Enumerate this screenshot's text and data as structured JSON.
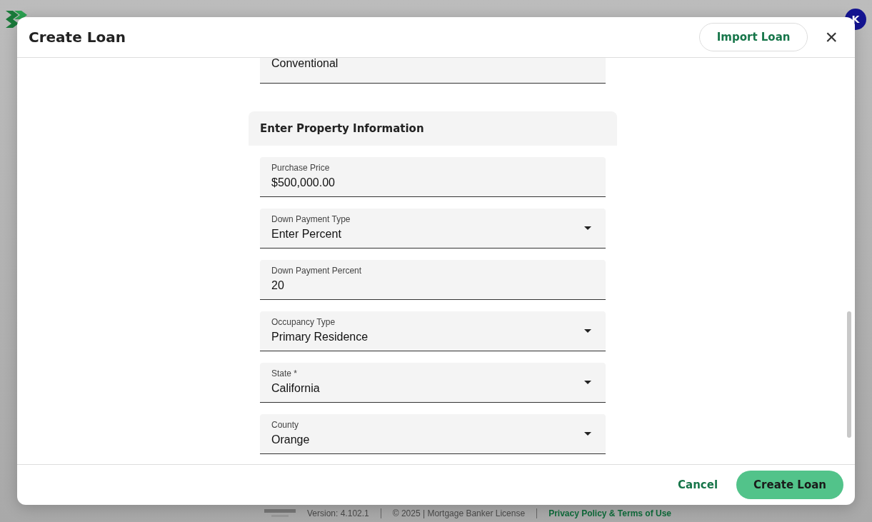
{
  "app": {
    "avatar": "K"
  },
  "footer": {
    "version": "Version: 4.102.1",
    "copyright": "© 2025 | Mortgage Banker License",
    "link": "Privacy Policy & Terms of Use"
  },
  "dialog": {
    "title": "Create Loan",
    "import_button": "Import Loan",
    "close": "×",
    "top_field": {
      "value": "Conventional"
    },
    "section": "Enter Property Information",
    "fields": [
      {
        "kind": "text",
        "label": "Purchase Price",
        "value": "$500,000.00"
      },
      {
        "kind": "select",
        "label": "Down Payment Type",
        "value": "Enter Percent"
      },
      {
        "kind": "text",
        "label": "Down Payment Percent",
        "value": "20"
      },
      {
        "kind": "select",
        "label": "Occupancy Type",
        "value": "Primary Residence"
      },
      {
        "kind": "select",
        "label": "State *",
        "value": "California"
      },
      {
        "kind": "select",
        "label": "County",
        "value": "Orange"
      }
    ],
    "buttons": {
      "cancel": "Cancel",
      "create": "Create Loan"
    }
  }
}
